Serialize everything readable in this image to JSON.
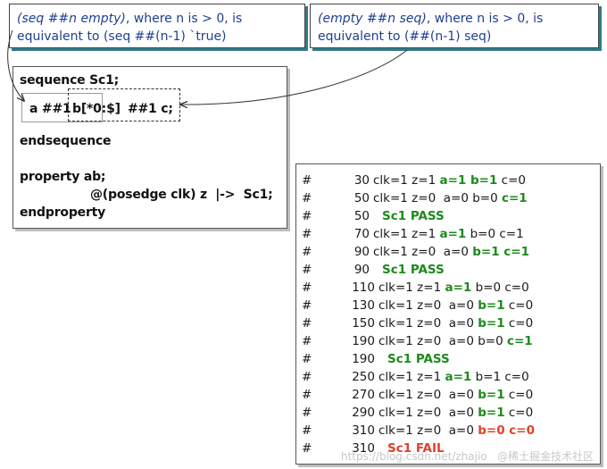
{
  "notes": {
    "left": {
      "line1_italic": "(seq ##n empty)",
      "line1_rest": ", where n is > 0, is",
      "line2": "equivalent to (seq ##(n-1) `true)"
    },
    "right": {
      "line1_italic": "(empty ##n seq)",
      "line1_rest": ", where n is > 0, is",
      "line2": "equivalent to (##(n-1) seq)"
    }
  },
  "code": {
    "line1": "sequence Sc1;",
    "seq_a": "a ##1",
    "seq_b": "b[*0:$]",
    "seq_c": "##1 c;",
    "line3": "endsequence",
    "line4": "property ab;",
    "line5": "@(posedge clk) z  |->  Sc1;",
    "line6": "endproperty"
  },
  "log": {
    "hash": "#",
    "rows": [
      {
        "time": "30",
        "parts": [
          [
            "clk=1 z=1 ",
            ""
          ],
          [
            "a=1 b=1",
            "green"
          ],
          [
            " c=0",
            ""
          ]
        ]
      },
      {
        "time": "50",
        "parts": [
          [
            "clk=1 z=0  a=0 b=0 ",
            ""
          ],
          [
            "c=1",
            "green"
          ]
        ]
      },
      {
        "time": "50",
        "parts": [
          [
            "Sc1 PASS",
            "pass"
          ]
        ],
        "pass": true
      },
      {
        "time": "70",
        "parts": [
          [
            "clk=1 z=1 ",
            ""
          ],
          [
            "a=1",
            "green"
          ],
          [
            " b=0 c=1",
            ""
          ]
        ]
      },
      {
        "time": "90",
        "parts": [
          [
            "clk=1 z=0  a=0 ",
            ""
          ],
          [
            "b=1 c=1",
            "green"
          ]
        ]
      },
      {
        "time": "90",
        "parts": [
          [
            "Sc1 PASS",
            "pass"
          ]
        ],
        "pass": true
      },
      {
        "time": "110",
        "parts": [
          [
            "clk=1 z=1 ",
            ""
          ],
          [
            "a=1",
            "green"
          ],
          [
            " b=0 c=0",
            ""
          ]
        ]
      },
      {
        "time": "130",
        "parts": [
          [
            "clk=1 z=0  a=0 ",
            ""
          ],
          [
            "b=1",
            "green"
          ],
          [
            " c=0",
            ""
          ]
        ]
      },
      {
        "time": "150",
        "parts": [
          [
            "clk=1 z=0  a=0 ",
            ""
          ],
          [
            "b=1",
            "green"
          ],
          [
            " c=0",
            ""
          ]
        ]
      },
      {
        "time": "190",
        "parts": [
          [
            "clk=1 z=0  a=0 b=0 ",
            ""
          ],
          [
            "c=1",
            "green"
          ]
        ]
      },
      {
        "time": "190",
        "parts": [
          [
            "Sc1 PASS",
            "pass"
          ]
        ],
        "pass": true
      },
      {
        "time": "250",
        "parts": [
          [
            "clk=1 z=1 ",
            ""
          ],
          [
            "a=1",
            "green"
          ],
          [
            " b=1 c=0",
            ""
          ]
        ]
      },
      {
        "time": "270",
        "parts": [
          [
            "clk=1 z=0  a=0 ",
            ""
          ],
          [
            "b=1",
            "green"
          ],
          [
            " c=0",
            ""
          ]
        ]
      },
      {
        "time": "290",
        "parts": [
          [
            "clk=1 z=0  a=0 ",
            ""
          ],
          [
            "b=1",
            "green"
          ],
          [
            " c=0",
            ""
          ]
        ]
      },
      {
        "time": "310",
        "parts": [
          [
            "clk=1 z=0  a=0 ",
            ""
          ],
          [
            "b=0 c=0",
            "red"
          ]
        ]
      },
      {
        "time": "310",
        "parts": [
          [
            "Sc1 FAIL",
            "red"
          ]
        ],
        "pass": true
      }
    ]
  },
  "watermark": "https://blog.csdn.net/zhajio   @稀土掘金技术社区"
}
